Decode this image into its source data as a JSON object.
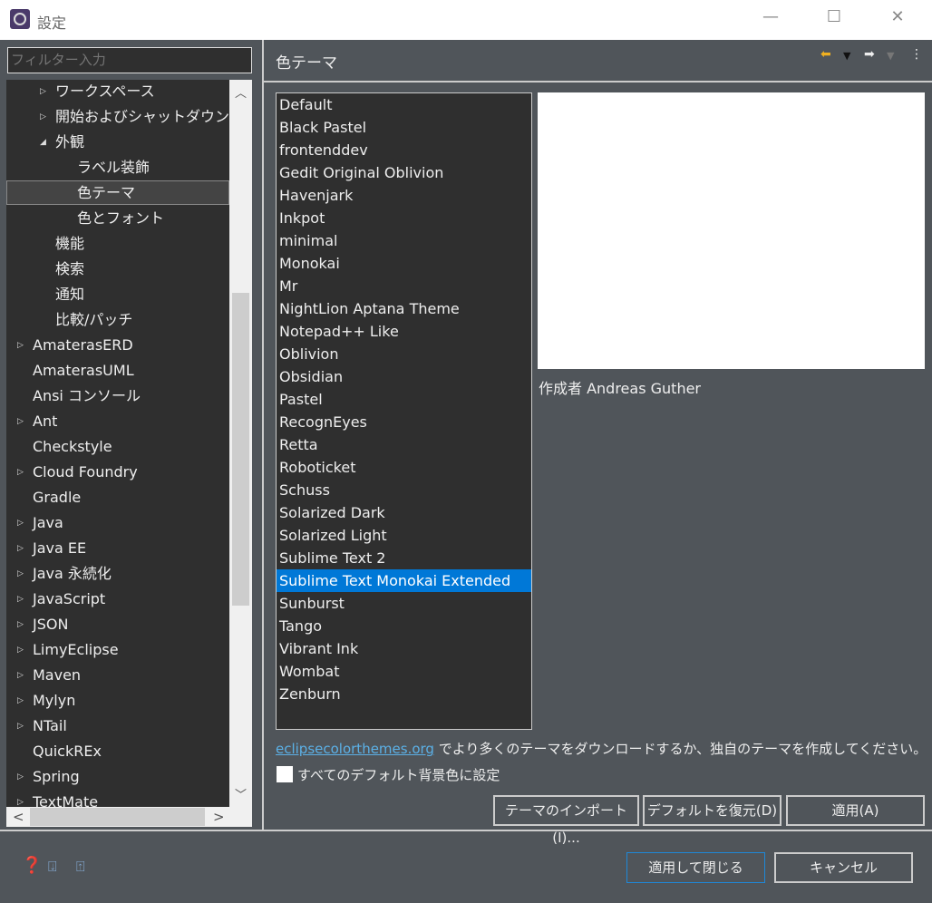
{
  "window": {
    "title": "設定",
    "minimize": "—",
    "maximize": "☐",
    "close": "✕"
  },
  "filter": {
    "placeholder": "フィルター入力"
  },
  "tree": [
    {
      "label": "ワークスペース",
      "level": 1,
      "arrow": "collapsed"
    },
    {
      "label": "開始およびシャットダウン",
      "level": 1,
      "arrow": "collapsed"
    },
    {
      "label": "外観",
      "level": 1,
      "arrow": "expanded"
    },
    {
      "label": "ラベル装飾",
      "level": 2,
      "arrow": ""
    },
    {
      "label": "色テーマ",
      "level": 2,
      "arrow": "",
      "selected": true
    },
    {
      "label": "色とフォント",
      "level": 2,
      "arrow": ""
    },
    {
      "label": "機能",
      "level": 1,
      "arrow": ""
    },
    {
      "label": "検索",
      "level": 1,
      "arrow": ""
    },
    {
      "label": "通知",
      "level": 1,
      "arrow": ""
    },
    {
      "label": "比較/パッチ",
      "level": 1,
      "arrow": ""
    },
    {
      "label": "AmaterasERD",
      "level": 0,
      "arrow": "collapsed"
    },
    {
      "label": "AmaterasUML",
      "level": 0,
      "arrow": ""
    },
    {
      "label": "Ansi コンソール",
      "level": 0,
      "arrow": ""
    },
    {
      "label": "Ant",
      "level": 0,
      "arrow": "collapsed"
    },
    {
      "label": "Checkstyle",
      "level": 0,
      "arrow": ""
    },
    {
      "label": "Cloud Foundry",
      "level": 0,
      "arrow": "collapsed"
    },
    {
      "label": "Gradle",
      "level": 0,
      "arrow": ""
    },
    {
      "label": "Java",
      "level": 0,
      "arrow": "collapsed"
    },
    {
      "label": "Java EE",
      "level": 0,
      "arrow": "collapsed"
    },
    {
      "label": "Java 永続化",
      "level": 0,
      "arrow": "collapsed"
    },
    {
      "label": "JavaScript",
      "level": 0,
      "arrow": "collapsed"
    },
    {
      "label": "JSON",
      "level": 0,
      "arrow": "collapsed"
    },
    {
      "label": "LimyEclipse",
      "level": 0,
      "arrow": "collapsed"
    },
    {
      "label": "Maven",
      "level": 0,
      "arrow": "collapsed"
    },
    {
      "label": "Mylyn",
      "level": 0,
      "arrow": "collapsed"
    },
    {
      "label": "NTail",
      "level": 0,
      "arrow": "collapsed"
    },
    {
      "label": "QuickREx",
      "level": 0,
      "arrow": ""
    },
    {
      "label": "Spring",
      "level": 0,
      "arrow": "collapsed"
    },
    {
      "label": "TextMate",
      "level": 0,
      "arrow": "collapsed"
    }
  ],
  "page": {
    "title": "色テーマ"
  },
  "themes": [
    "Default",
    "Black Pastel",
    "frontenddev",
    "Gedit Original Oblivion",
    "Havenjark",
    "Inkpot",
    "minimal",
    "Monokai",
    "Mr",
    "NightLion Aptana Theme",
    "Notepad++ Like",
    "Oblivion",
    "Obsidian",
    "Pastel",
    "RecognEyes",
    "Retta",
    "Roboticket",
    "Schuss",
    "Solarized Dark",
    "Solarized Light",
    "Sublime Text 2",
    "Sublime Text Monokai Extended",
    "Sunburst",
    "Tango",
    "Vibrant Ink",
    "Wombat",
    "Zenburn"
  ],
  "selected_theme": "Sublime Text Monokai Extended",
  "author": "作成者 Andreas Guther",
  "link": {
    "text": "eclipsecolorthemes.org",
    "suffix": " でより多くのテーマをダウンロードするか、独自のテーマを作成してください。"
  },
  "checkbox": {
    "label": "すべてのデフォルト背景色に設定",
    "checked": false
  },
  "buttons": {
    "import": "テーマのインポート(I)...",
    "restore": "デフォルトを復元(D)",
    "apply": "適用(A)",
    "apply_close": "適用して閉じる",
    "cancel": "キャンセル"
  },
  "colors": {
    "selection": "#0078d7",
    "link": "#5bb0e6",
    "background": "#50555a"
  }
}
